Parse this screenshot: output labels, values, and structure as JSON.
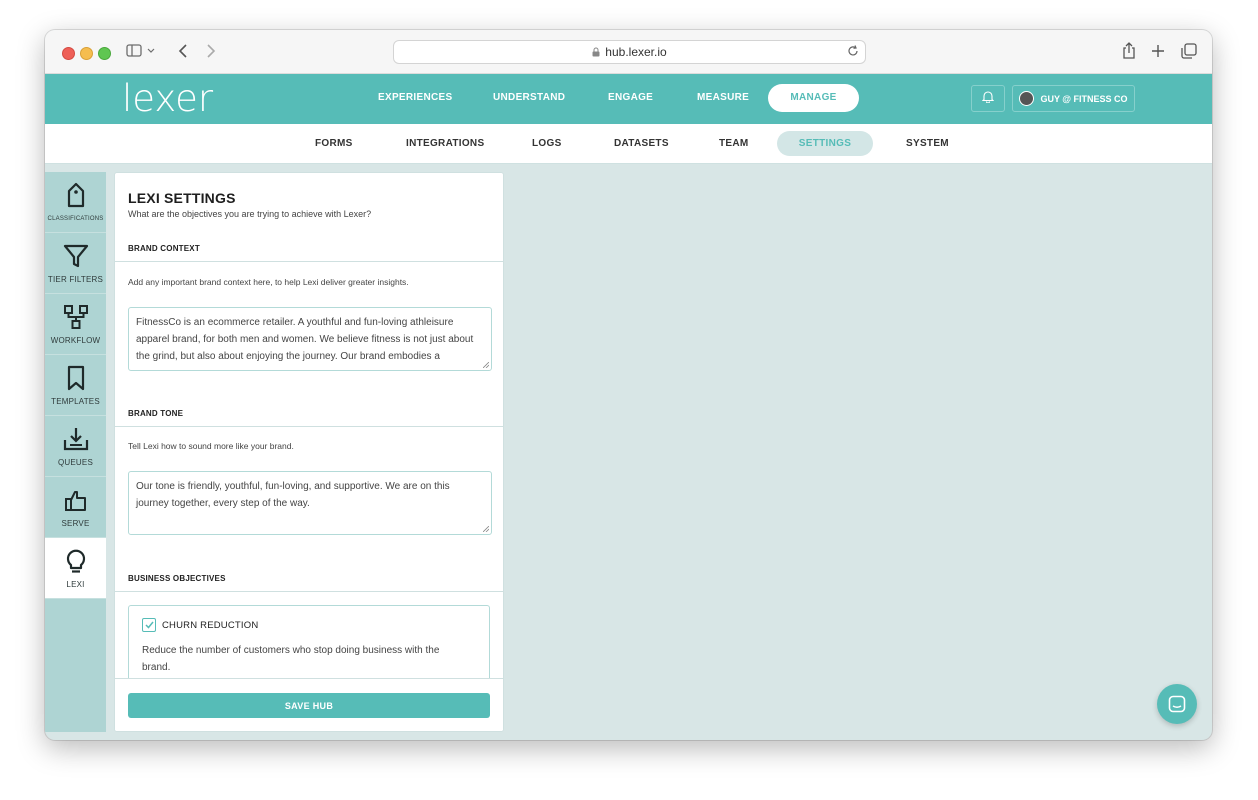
{
  "browser": {
    "url": "hub.lexer.io"
  },
  "brand": {
    "logo_text": "lexer",
    "accent": "#56bcb7"
  },
  "topnav": {
    "items": [
      "EXPERIENCES",
      "UNDERSTAND",
      "ENGAGE",
      "MEASURE",
      "MANAGE"
    ],
    "active": "MANAGE",
    "user_label": "GUY @ FITNESS CO"
  },
  "subnav": {
    "items": [
      "FORMS",
      "INTEGRATIONS",
      "LOGS",
      "DATASETS",
      "TEAM",
      "SETTINGS",
      "SYSTEM"
    ],
    "active": "SETTINGS"
  },
  "sidebar": {
    "items": [
      {
        "label": "CLASSIFICATIONS",
        "icon": "tag-icon"
      },
      {
        "label": "TIER FILTERS",
        "icon": "funnel-icon"
      },
      {
        "label": "WORKFLOW",
        "icon": "workflow-icon"
      },
      {
        "label": "TEMPLATES",
        "icon": "bookmark-icon"
      },
      {
        "label": "QUEUES",
        "icon": "download-tray-icon"
      },
      {
        "label": "SERVE",
        "icon": "thumbs-up-icon"
      },
      {
        "label": "LEXI",
        "icon": "lightbulb-icon"
      }
    ],
    "active": "LEXI"
  },
  "settings": {
    "title": "LEXI SETTINGS",
    "subtitle": "What are the objectives you are trying to achieve with Lexer?",
    "brand_context": {
      "heading": "BRAND CONTEXT",
      "help": "Add any important brand context here, to help Lexi deliver greater insights.",
      "value": "FitnessCo is an ecommerce retailer. A youthful and fun-loving athleisure apparel brand, for both men and women. We believe fitness is not just about the grind, but also about enjoying the journey. Our brand embodies a"
    },
    "brand_tone": {
      "heading": "BRAND TONE",
      "help": "Tell Lexi how to sound more like your brand.",
      "value": "Our tone is friendly, youthful, fun-loving, and supportive. We are on this journey together, every step of the way."
    },
    "business_objectives": {
      "heading": "BUSINESS OBJECTIVES",
      "items": [
        {
          "title": "CHURN REDUCTION",
          "checked": true,
          "description": "Reduce the number of customers who stop doing business with the brand."
        }
      ]
    },
    "save_label": "SAVE HUB"
  }
}
